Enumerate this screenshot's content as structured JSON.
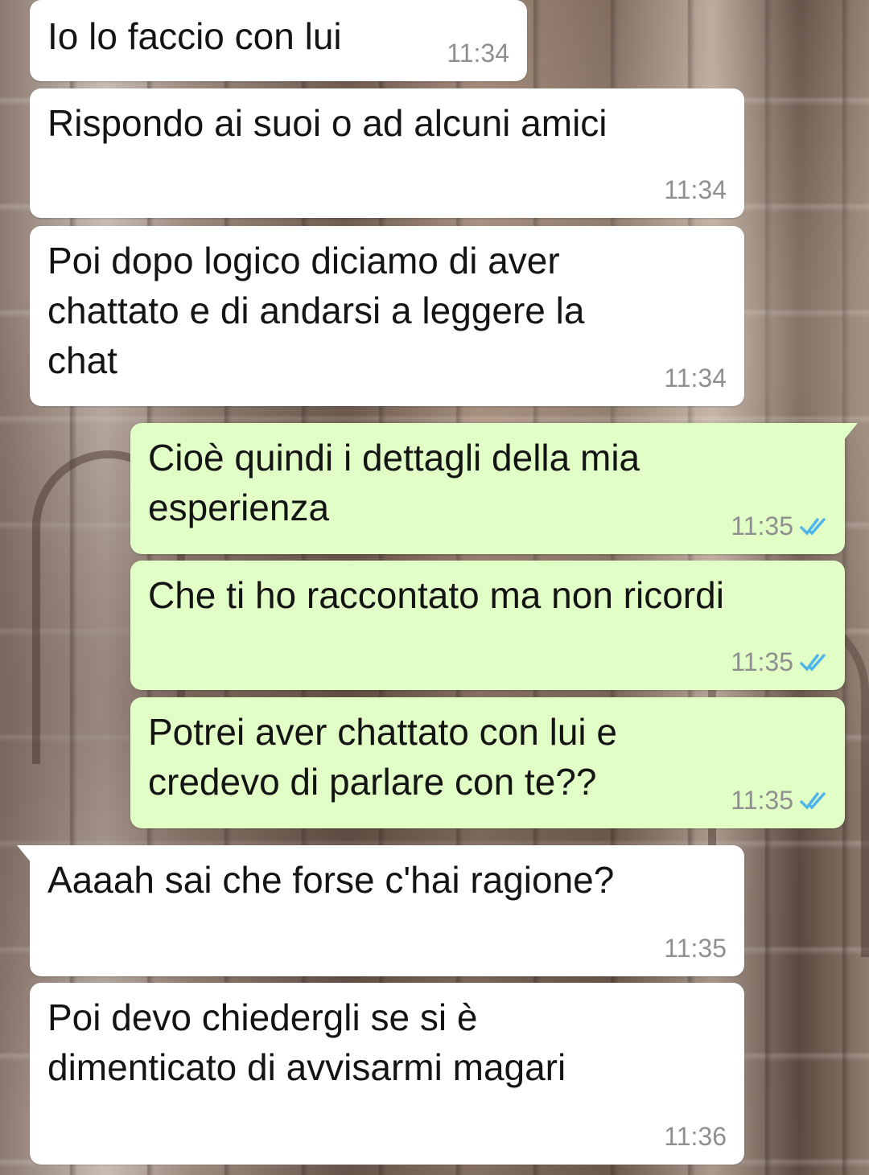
{
  "colors": {
    "incoming_bubble": "#ffffff",
    "outgoing_bubble": "#e1fec6",
    "timestamp": "#8f8f8f",
    "read_tick": "#4fb6ec"
  },
  "messages": [
    {
      "direction": "incoming",
      "text": "Io lo faccio con lui",
      "time": "11:34"
    },
    {
      "direction": "incoming",
      "text": "Rispondo ai suoi o ad alcuni amici",
      "time": "11:34"
    },
    {
      "direction": "incoming",
      "text": "Poi dopo logico diciamo di aver\nchattato e di andarsi a leggere la\nchat",
      "time": "11:34"
    },
    {
      "direction": "outgoing",
      "text": "Cioè quindi i dettagli della mia\nesperienza",
      "time": "11:35",
      "status_icon": "double-check-read-icon"
    },
    {
      "direction": "outgoing",
      "text": "Che ti ho raccontato ma non ricordi",
      "time": "11:35",
      "status_icon": "double-check-read-icon"
    },
    {
      "direction": "outgoing",
      "text": "Potrei aver chattato con lui e\ncredevo di parlare con te??",
      "time": "11:35",
      "status_icon": "double-check-read-icon"
    },
    {
      "direction": "incoming",
      "text": "Aaaah sai che forse c'hai ragione?",
      "time": "11:35"
    },
    {
      "direction": "incoming",
      "text": "Poi devo chiedergli se si è\ndimenticato di avvisarmi magari",
      "time": "11:36"
    }
  ]
}
